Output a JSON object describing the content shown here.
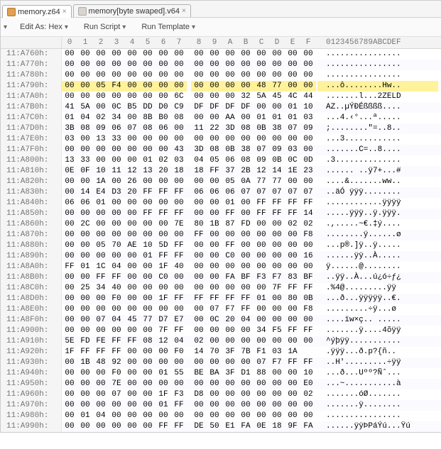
{
  "tabs": [
    {
      "label": "memory.z64",
      "active": true
    },
    {
      "label": "memory[byte swaped].v64",
      "active": false
    }
  ],
  "toolbar": {
    "edit_as_label": "Edit As: ",
    "edit_as_value": "Hex",
    "run_script_label": "Run Script",
    "run_template_label": "Run Template"
  },
  "columns": {
    "hex": [
      "0",
      "1",
      "2",
      "3",
      "4",
      "5",
      "6",
      "7",
      "8",
      "9",
      "A",
      "B",
      "C",
      "D",
      "E",
      "F"
    ],
    "ascii_header": "0123456789ABCDEF"
  },
  "rows": [
    {
      "addr": "11:A760h:",
      "hex": [
        "00",
        "00",
        "00",
        "00",
        "00",
        "00",
        "00",
        "00",
        "00",
        "00",
        "00",
        "00",
        "00",
        "00",
        "00",
        "00"
      ],
      "ascii": "................",
      "hl": false
    },
    {
      "addr": "11:A770h:",
      "hex": [
        "00",
        "00",
        "00",
        "00",
        "00",
        "00",
        "00",
        "00",
        "00",
        "00",
        "00",
        "00",
        "00",
        "00",
        "00",
        "00"
      ],
      "ascii": "................",
      "hl": false
    },
    {
      "addr": "11:A780h:",
      "hex": [
        "00",
        "00",
        "00",
        "00",
        "00",
        "00",
        "00",
        "00",
        "00",
        "00",
        "00",
        "00",
        "00",
        "00",
        "00",
        "00"
      ],
      "ascii": "................",
      "hl": false
    },
    {
      "addr": "11:A790h:",
      "hex": [
        "00",
        "00",
        "05",
        "F4",
        "00",
        "00",
        "00",
        "00",
        "00",
        "00",
        "00",
        "00",
        "48",
        "77",
        "00",
        "00"
      ],
      "ascii": "...ô........Hw..",
      "hl": true
    },
    {
      "addr": "11:A7A0h:",
      "hex": [
        "00",
        "00",
        "00",
        "00",
        "00",
        "00",
        "00",
        "6C",
        "00",
        "00",
        "00",
        "32",
        "5A",
        "45",
        "4C",
        "44"
      ],
      "ascii": ".......l...2ZELD",
      "hl": false
    },
    {
      "addr": "11:A7B0h:",
      "hex": [
        "41",
        "5A",
        "00",
        "0C",
        "B5",
        "DD",
        "D0",
        "C9",
        "DF",
        "DF",
        "DF",
        "DF",
        "00",
        "00",
        "01",
        "10"
      ],
      "ascii": "AZ..µÝÐÉßßßß....",
      "hl": false
    },
    {
      "addr": "11:A7C0h:",
      "hex": [
        "01",
        "04",
        "02",
        "34",
        "00",
        "8B",
        "B0",
        "08",
        "00",
        "00",
        "AA",
        "00",
        "01",
        "01",
        "01",
        "03"
      ],
      "ascii": "...4.‹°...ª.....",
      "hl": false
    },
    {
      "addr": "11:A7D0h:",
      "hex": [
        "3B",
        "08",
        "09",
        "06",
        "07",
        "08",
        "06",
        "00",
        "11",
        "22",
        "3D",
        "08",
        "0B",
        "38",
        "07",
        "09"
      ],
      "ascii": ";........\"=..8..",
      "hl": false
    },
    {
      "addr": "11:A7E0h:",
      "hex": [
        "03",
        "00",
        "13",
        "33",
        "00",
        "00",
        "00",
        "00",
        "00",
        "00",
        "00",
        "00",
        "00",
        "00",
        "00",
        "00"
      ],
      "ascii": "...3............",
      "hl": false
    },
    {
      "addr": "11:A7F0h:",
      "hex": [
        "00",
        "00",
        "00",
        "00",
        "00",
        "00",
        "00",
        "43",
        "3D",
        "08",
        "0B",
        "38",
        "07",
        "09",
        "03",
        "00"
      ],
      "ascii": ".......C=..8....",
      "hl": false
    },
    {
      "addr": "11:A800h:",
      "hex": [
        "13",
        "33",
        "00",
        "00",
        "00",
        "01",
        "02",
        "03",
        "04",
        "05",
        "06",
        "08",
        "09",
        "0B",
        "0C",
        "0D"
      ],
      "ascii": ".3..............",
      "hl": false
    },
    {
      "addr": "11:A810h:",
      "hex": [
        "0E",
        "0F",
        "10",
        "11",
        "12",
        "13",
        "20",
        "18",
        "18",
        "FF",
        "37",
        "2B",
        "12",
        "14",
        "1E",
        "23"
      ],
      "ascii": "...... ..ÿ7+...#",
      "hl": false
    },
    {
      "addr": "11:A820h:",
      "hex": [
        "00",
        "00",
        "1A",
        "00",
        "26",
        "00",
        "00",
        "00",
        "00",
        "00",
        "05",
        "0A",
        "77",
        "77",
        "00",
        "00"
      ],
      "ascii": "....&.......ww..",
      "hl": false
    },
    {
      "addr": "11:A830h:",
      "hex": [
        "00",
        "14",
        "E4",
        "D3",
        "20",
        "FF",
        "FF",
        "FF",
        "06",
        "06",
        "06",
        "07",
        "07",
        "07",
        "07",
        "07"
      ],
      "ascii": "..äÓ ÿÿÿ........",
      "hl": false
    },
    {
      "addr": "11:A840h:",
      "hex": [
        "06",
        "06",
        "01",
        "00",
        "00",
        "00",
        "00",
        "00",
        "00",
        "00",
        "01",
        "00",
        "FF",
        "FF",
        "FF",
        "FF"
      ],
      "ascii": "............ÿÿÿÿ",
      "hl": false
    },
    {
      "addr": "11:A850h:",
      "hex": [
        "00",
        "00",
        "00",
        "00",
        "00",
        "FF",
        "FF",
        "FF",
        "00",
        "00",
        "FF",
        "00",
        "FF",
        "FF",
        "FF",
        "14"
      ],
      "ascii": ".....ÿÿÿ..ÿ.ÿÿÿ.",
      "hl": false
    },
    {
      "addr": "11:A860h:",
      "hex": [
        "00",
        "2C",
        "00",
        "00",
        "00",
        "00",
        "00",
        "7E",
        "80",
        "1B",
        "87",
        "FD",
        "00",
        "00",
        "02",
        "02"
      ],
      "ascii": ".,.....~€.‡ý....",
      "hl": false
    },
    {
      "addr": "11:A870h:",
      "hex": [
        "00",
        "00",
        "00",
        "00",
        "00",
        "00",
        "00",
        "00",
        "FF",
        "00",
        "00",
        "00",
        "00",
        "00",
        "00",
        "F8"
      ],
      "ascii": "........ÿ......ø",
      "hl": false
    },
    {
      "addr": "11:A880h:",
      "hex": [
        "00",
        "00",
        "05",
        "70",
        "AE",
        "10",
        "5D",
        "FF",
        "00",
        "00",
        "FF",
        "00",
        "00",
        "00",
        "00",
        "00"
      ],
      "ascii": "...p®.]ÿ..ÿ.....",
      "hl": false
    },
    {
      "addr": "11:A890h:",
      "hex": [
        "00",
        "00",
        "00",
        "00",
        "00",
        "01",
        "FF",
        "FF",
        "00",
        "00",
        "C0",
        "00",
        "00",
        "00",
        "00",
        "16"
      ],
      "ascii": "......ÿÿ..À.....",
      "hl": false
    },
    {
      "addr": "11:A8A0h:",
      "hex": [
        "FF",
        "01",
        "1C",
        "04",
        "00",
        "00",
        "1F",
        "40",
        "00",
        "00",
        "00",
        "00",
        "00",
        "00",
        "00",
        "00"
      ],
      "ascii": "ÿ......@........",
      "hl": false
    },
    {
      "addr": "11:A8B0h:",
      "hex": [
        "00",
        "00",
        "FF",
        "FF",
        "00",
        "00",
        "C0",
        "00",
        "00",
        "00",
        "FA",
        "BF",
        "F3",
        "F7",
        "83",
        "BF"
      ],
      "ascii": "..ÿÿ..À...ú¿ó÷ƒ¿",
      "hl": false
    },
    {
      "addr": "11:A8C0h:",
      "hex": [
        "00",
        "25",
        "34",
        "40",
        "00",
        "00",
        "00",
        "00",
        "00",
        "00",
        "00",
        "00",
        "00",
        "7F",
        "FF",
        "FF"
      ],
      "ascii": ".%4@.........ÿÿ",
      "hl": false
    },
    {
      "addr": "11:A8D0h:",
      "hex": [
        "00",
        "00",
        "00",
        "F0",
        "00",
        "00",
        "1F",
        "FF",
        "FF",
        "FF",
        "FF",
        "FF",
        "01",
        "00",
        "80",
        "0B"
      ],
      "ascii": "...ð...ÿÿÿÿÿ..€.",
      "hl": false
    },
    {
      "addr": "11:A8E0h:",
      "hex": [
        "00",
        "00",
        "00",
        "00",
        "00",
        "00",
        "00",
        "00",
        "00",
        "07",
        "F7",
        "FF",
        "00",
        "00",
        "00",
        "F8"
      ],
      "ascii": ".........÷ÿ...ø",
      "hl": false
    },
    {
      "addr": "11:A8F0h:",
      "hex": [
        "00",
        "00",
        "07",
        "04",
        "45",
        "77",
        "D7",
        "E7",
        "00",
        "0C",
        "20",
        "04",
        "00",
        "00",
        "00",
        "00"
      ],
      "ascii": "....ïw×ç.. .....",
      "hl": false
    },
    {
      "addr": "11:A900h:",
      "hex": [
        "00",
        "00",
        "00",
        "00",
        "00",
        "00",
        "7F",
        "FF",
        "00",
        "00",
        "00",
        "00",
        "34",
        "F5",
        "FF",
        "FF"
      ],
      "ascii": ".......ÿ....4õÿÿ",
      "hl": false
    },
    {
      "addr": "11:A910h:",
      "hex": [
        "5E",
        "FD",
        "FE",
        "FF",
        "FF",
        "08",
        "12",
        "04",
        "02",
        "00",
        "00",
        "00",
        "00",
        "00",
        "00",
        "00"
      ],
      "ascii": "^ýþÿÿ...........",
      "hl": false
    },
    {
      "addr": "11:A920h:",
      "hex": [
        "1F",
        "FF",
        "FF",
        "FF",
        "00",
        "00",
        "00",
        "F0",
        "14",
        "70",
        "3F",
        "7B",
        "F1",
        "03",
        "1A"
      ],
      "ascii": ".ÿÿÿ...ð.p?{ñ..",
      "hl": false
    },
    {
      "addr": "11:A930h:",
      "hex": [
        "00",
        "1B",
        "48",
        "92",
        "00",
        "00",
        "00",
        "00",
        "00",
        "00",
        "00",
        "00",
        "07",
        "F7",
        "FF",
        "FF"
      ],
      "ascii": "..H'.........÷ÿÿ",
      "hl": false
    },
    {
      "addr": "11:A940h:",
      "hex": [
        "00",
        "00",
        "00",
        "F0",
        "00",
        "00",
        "01",
        "55",
        "BE",
        "BA",
        "3F",
        "D1",
        "88",
        "00",
        "00",
        "10"
      ],
      "ascii": "...ð...Uºº?Ñˆ...",
      "hl": false
    },
    {
      "addr": "11:A950h:",
      "hex": [
        "00",
        "00",
        "00",
        "7E",
        "00",
        "00",
        "00",
        "00",
        "00",
        "00",
        "00",
        "00",
        "00",
        "00",
        "00",
        "E0"
      ],
      "ascii": "...~...........à",
      "hl": false
    },
    {
      "addr": "11:A960h:",
      "hex": [
        "00",
        "00",
        "00",
        "07",
        "00",
        "00",
        "1F",
        "F3",
        "D8",
        "00",
        "00",
        "00",
        "00",
        "00",
        "00",
        "02"
      ],
      "ascii": ".......óØ.......",
      "hl": false
    },
    {
      "addr": "11:A970h:",
      "hex": [
        "00",
        "00",
        "00",
        "00",
        "00",
        "00",
        "01",
        "FF",
        "00",
        "00",
        "00",
        "00",
        "00",
        "00",
        "00",
        "00"
      ],
      "ascii": ".......ÿ........",
      "hl": false
    },
    {
      "addr": "11:A980h:",
      "hex": [
        "00",
        "01",
        "04",
        "00",
        "00",
        "00",
        "00",
        "00",
        "00",
        "00",
        "00",
        "00",
        "00",
        "00",
        "00",
        "00"
      ],
      "ascii": "................",
      "hl": false
    },
    {
      "addr": "11:A990h:",
      "hex": [
        "00",
        "00",
        "00",
        "00",
        "00",
        "00",
        "FF",
        "FF",
        "DE",
        "50",
        "E1",
        "FA",
        "0E",
        "18",
        "9F",
        "FA"
      ],
      "ascii": "......ÿÿÞPáÝú...Ÿú",
      "hl": false
    }
  ]
}
